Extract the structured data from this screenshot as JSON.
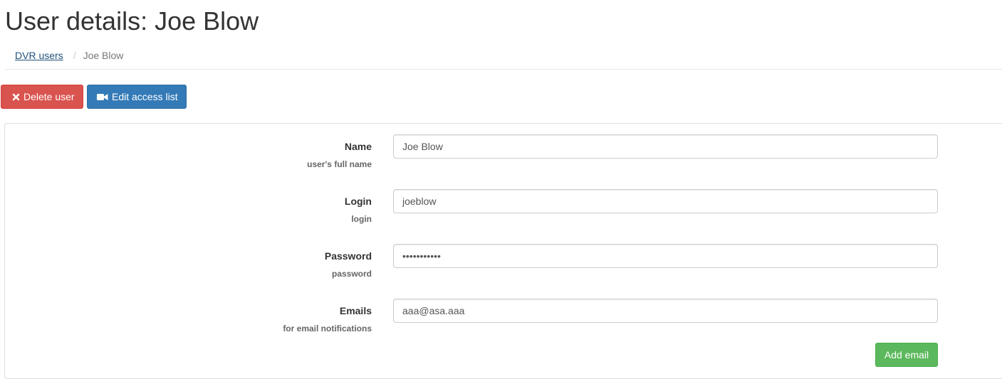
{
  "page": {
    "title": "User details: Joe Blow"
  },
  "breadcrumb": {
    "parent": "DVR users",
    "current": "Joe Blow",
    "separator": "/"
  },
  "actions": {
    "delete_label": "Delete user",
    "delete_icon": "times-icon",
    "edit_access_label": "Edit access list",
    "edit_access_icon": "video-camera-icon"
  },
  "form": {
    "name": {
      "label": "Name",
      "help": "user's full name",
      "value": "Joe Blow"
    },
    "login": {
      "label": "Login",
      "help": "login",
      "value": "joeblow"
    },
    "password": {
      "label": "Password",
      "help": "password",
      "value": "•••••••••••"
    },
    "emails": {
      "label": "Emails",
      "help": "for email notifications",
      "value": "aaa@asa.aaa"
    },
    "add_email_label": "Add email"
  },
  "colors": {
    "danger": "#d9534f",
    "primary": "#337ab7",
    "success": "#5cb85c",
    "link": "#23527c"
  }
}
